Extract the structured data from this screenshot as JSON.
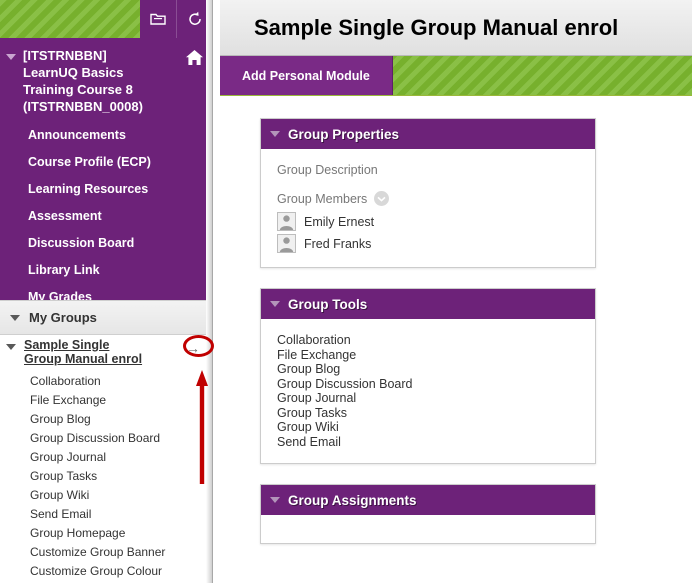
{
  "sidebar": {
    "toolbar": {
      "collapse_icon": "folder-collapse-icon",
      "refresh_icon": "refresh-icon"
    },
    "course": {
      "title": "[ITSTRNBBN] LearnUQ Basics Training Course 8 (ITSTRNBBN_0008)",
      "home_icon": "home-icon"
    },
    "links": [
      {
        "label": "Announcements"
      },
      {
        "label": "Course Profile (ECP)"
      },
      {
        "label": "Learning Resources"
      },
      {
        "label": "Assessment"
      },
      {
        "label": "Discussion Board"
      },
      {
        "label": "Library Link"
      },
      {
        "label": "My Grades"
      }
    ],
    "my_groups": {
      "label": "My Groups",
      "group_name": "Sample Single Group Manual enrol",
      "group_arrow": "→",
      "items": [
        {
          "label": "Collaboration"
        },
        {
          "label": "File Exchange"
        },
        {
          "label": "Group Blog"
        },
        {
          "label": "Group Discussion Board"
        },
        {
          "label": "Group Journal"
        },
        {
          "label": "Group Tasks"
        },
        {
          "label": "Group Wiki"
        },
        {
          "label": "Send Email"
        },
        {
          "label": "Group Homepage"
        },
        {
          "label": "Customize Group Banner"
        },
        {
          "label": "Customize Group Colour"
        }
      ]
    }
  },
  "main": {
    "page_title": "Sample Single Group Manual enrol",
    "add_personal_module": "Add Personal Module",
    "panels": {
      "group_properties": {
        "title": "Group Properties",
        "description_label": "Group Description",
        "members_label": "Group Members",
        "members": [
          {
            "name": "Emily Ernest"
          },
          {
            "name": "Fred Franks"
          }
        ]
      },
      "group_tools": {
        "title": "Group Tools",
        "items": [
          {
            "label": "Collaboration"
          },
          {
            "label": "File Exchange"
          },
          {
            "label": "Group Blog"
          },
          {
            "label": "Group Discussion Board"
          },
          {
            "label": "Group Journal"
          },
          {
            "label": "Group Tasks"
          },
          {
            "label": "Group Wiki"
          },
          {
            "label": "Send Email"
          }
        ]
      },
      "group_assignments": {
        "title": "Group Assignments"
      }
    }
  },
  "annotations": {
    "circle_color": "#c00000",
    "arrow_color": "#c00000"
  },
  "colors": {
    "purple": "#6d2279",
    "green": "#7cb82f"
  }
}
